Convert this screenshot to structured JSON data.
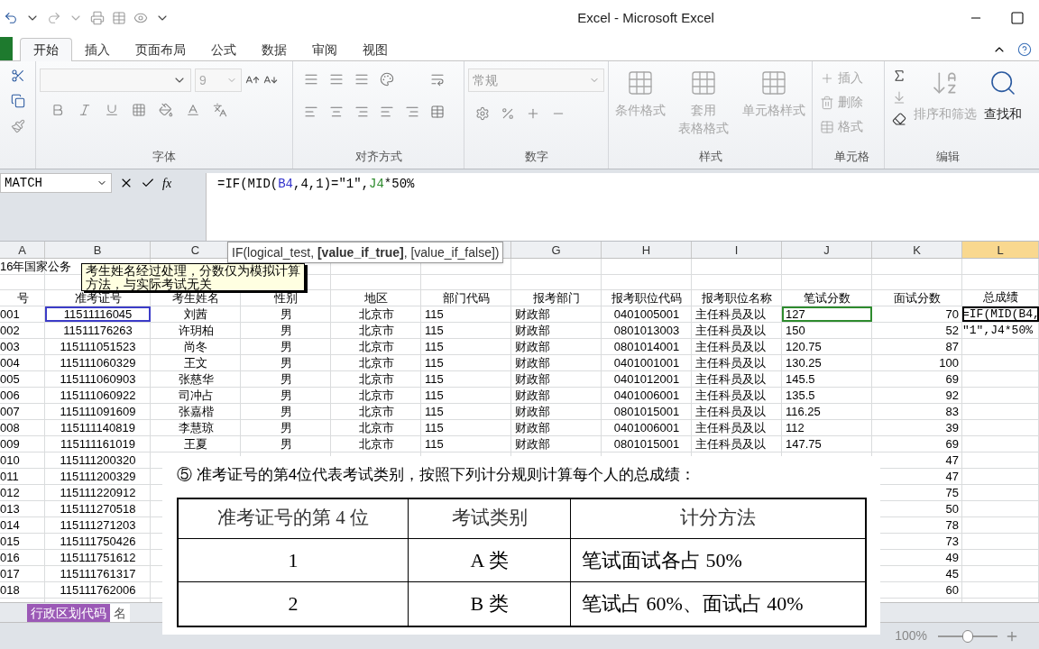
{
  "window": {
    "title": "Excel - Microsoft Excel"
  },
  "tabs": [
    {
      "label": "开始",
      "selected": true
    },
    {
      "label": "插入",
      "selected": false
    },
    {
      "label": "页面布局",
      "selected": false
    },
    {
      "label": "公式",
      "selected": false
    },
    {
      "label": "数据",
      "selected": false
    },
    {
      "label": "审阅",
      "selected": false
    },
    {
      "label": "视图",
      "selected": false
    }
  ],
  "ribbon": {
    "font_size": "9",
    "number_format": "常规",
    "group_labels": [
      "字体",
      "对齐方式",
      "数字",
      "样式",
      "单元格",
      "编辑"
    ],
    "style_buttons": [
      {
        "lines": [
          "条件格式"
        ],
        "disabled": true
      },
      {
        "lines": [
          "套用",
          "表格格式"
        ],
        "disabled": true
      },
      {
        "lines": [
          "单元格样式"
        ],
        "disabled": true
      }
    ],
    "cell_buttons": [
      {
        "label": "插入",
        "disabled": true
      },
      {
        "label": "删除",
        "disabled": true
      },
      {
        "label": "格式",
        "disabled": true
      }
    ],
    "edit_buttons": [
      {
        "label": "排序和筛选",
        "disabled": true
      },
      {
        "label": "查找和",
        "disabled": false
      }
    ]
  },
  "formula_bar": {
    "name_box": "MATCH",
    "fx": "fx",
    "segments": [
      {
        "text": "=IF(MID(",
        "color": "#000000"
      },
      {
        "text": "B4",
        "color": "#3333cc"
      },
      {
        "text": ",4,1)=″1″,",
        "color": "#000000"
      },
      {
        "text": "J4",
        "color": "#2e8b2e"
      },
      {
        "text": "*50%",
        "color": "#000000"
      }
    ]
  },
  "column_headers": {
    "A": "A",
    "B": "B",
    "C": "C",
    "G": "G",
    "H": "H",
    "I": "I",
    "J": "J",
    "K": "K",
    "L": "L"
  },
  "rows": [
    {
      "kind": "title",
      "cells": {
        "A": "16年国家公务"
      }
    },
    {
      "kind": "blank"
    },
    {
      "kind": "header",
      "cells": {
        "A": "号",
        "B": "准考证号",
        "C": "考生姓名",
        "D": "性别",
        "E": "地区",
        "F": "部门代码",
        "G": "报考部门",
        "H": "报考职位代码",
        "I": "报考职位名称",
        "J": "笔试分数",
        "K": "面试分数",
        "L": "总成绩"
      }
    },
    {
      "kind": "data",
      "cells": {
        "A": "001",
        "B": "11511116045",
        "C": "刘茜",
        "D": "男",
        "E": "北京市",
        "F": "115",
        "G": "财政部",
        "H": "0401005001",
        "I": "主任科员及以",
        "J": "127",
        "K": "70",
        "L": "=IF(MID(B4,"
      },
      "highlights": {
        "B": {
          "color": "#3c3cc8"
        },
        "J": {
          "color": "#2e8b2e"
        },
        "L": {
          "color": "#000000"
        }
      }
    },
    {
      "kind": "data",
      "cells": {
        "A": "002",
        "B": "11511176263",
        "C": "许玥柏",
        "D": "男",
        "E": "北京市",
        "F": "115",
        "G": "财政部",
        "H": "0801013003",
        "I": "主任科员及以",
        "J": "150",
        "K": "52",
        "L": "″1″,J4*50%"
      }
    },
    {
      "kind": "data",
      "cells": {
        "A": "003",
        "B": "115111051523",
        "C": "尚冬",
        "D": "男",
        "E": "北京市",
        "F": "115",
        "G": "财政部",
        "H": "0801014001",
        "I": "主任科员及以",
        "J": "120.75",
        "K": "87"
      }
    },
    {
      "kind": "data",
      "cells": {
        "A": "004",
        "B": "115111060329",
        "C": "王文",
        "D": "男",
        "E": "北京市",
        "F": "115",
        "G": "财政部",
        "H": "0401001001",
        "I": "主任科员及以",
        "J": "130.25",
        "K": "100"
      }
    },
    {
      "kind": "data",
      "cells": {
        "A": "005",
        "B": "115111060903",
        "C": "张慈华",
        "D": "男",
        "E": "北京市",
        "F": "115",
        "G": "财政部",
        "H": "0401012001",
        "I": "主任科员及以",
        "J": "145.5",
        "K": "69"
      }
    },
    {
      "kind": "data",
      "cells": {
        "A": "006",
        "B": "115111060922",
        "C": "司冲占",
        "D": "男",
        "E": "北京市",
        "F": "115",
        "G": "财政部",
        "H": "0401006001",
        "I": "主任科员及以",
        "J": "135.5",
        "K": "92"
      }
    },
    {
      "kind": "data",
      "cells": {
        "A": "007",
        "B": "115111091609",
        "C": "张嘉楷",
        "D": "男",
        "E": "北京市",
        "F": "115",
        "G": "财政部",
        "H": "0801015001",
        "I": "主任科员及以",
        "J": "116.25",
        "K": "83"
      }
    },
    {
      "kind": "data",
      "cells": {
        "A": "008",
        "B": "115111140819",
        "C": "李慧琼",
        "D": "男",
        "E": "北京市",
        "F": "115",
        "G": "财政部",
        "H": "0401006001",
        "I": "主任科员及以",
        "J": "112",
        "K": "39"
      }
    },
    {
      "kind": "data",
      "cells": {
        "A": "009",
        "B": "115111161019",
        "C": "王夏",
        "D": "男",
        "E": "北京市",
        "F": "115",
        "G": "财政部",
        "H": "0801015001",
        "I": "主任科员及以",
        "J": "147.75",
        "K": "69"
      }
    },
    {
      "kind": "data",
      "cells": {
        "A": "010",
        "B": "115111200320",
        "K": "47"
      }
    },
    {
      "kind": "data",
      "cells": {
        "A": "011",
        "B": "115111200329",
        "K": "47"
      }
    },
    {
      "kind": "data",
      "cells": {
        "A": "012",
        "B": "115111220912",
        "K": "75"
      }
    },
    {
      "kind": "data",
      "cells": {
        "A": "013",
        "B": "115111270518",
        "K": "50"
      }
    },
    {
      "kind": "data",
      "cells": {
        "A": "014",
        "B": "115111271203",
        "K": "78"
      }
    },
    {
      "kind": "data",
      "cells": {
        "A": "015",
        "B": "115111750426",
        "K": "73"
      }
    },
    {
      "kind": "data",
      "cells": {
        "A": "016",
        "B": "115111751612",
        "K": "49"
      }
    },
    {
      "kind": "data",
      "cells": {
        "A": "017",
        "B": "115111761317",
        "K": "45"
      }
    },
    {
      "kind": "data",
      "cells": {
        "A": "018",
        "B": "115111762006",
        "K": "60"
      }
    }
  ],
  "tooltip": "IF(logical_test, **[value_if_true]**, [value_if_false])",
  "comment": "考生姓名经过处理，分数仅为模拟计算方法，与实际考试无关",
  "sheet_tabs": [
    {
      "label": "行政区划代码",
      "selected": true
    },
    {
      "label": "名",
      "selected": false
    }
  ],
  "status_bar": {
    "zoom": "100%",
    "zoom_slider": {
      "level": 0.5
    }
  },
  "overlay": {
    "instruction": "⑤ 准考证号的第4位代表考试类别，按照下列计分规则计算每个人的总成绩：",
    "table": {
      "columns": [
        "准考证号的第 4 位",
        "考试类别",
        "计分方法"
      ],
      "rows": [
        [
          "1",
          "A 类",
          "笔试面试各占 50%"
        ],
        [
          "2",
          "B 类",
          "笔试占 60%、面试占 40%"
        ]
      ]
    }
  }
}
